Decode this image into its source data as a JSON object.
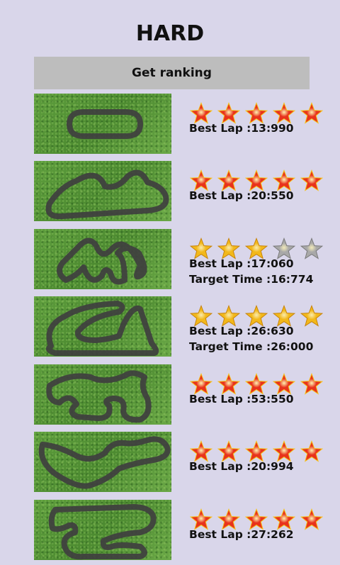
{
  "header": {
    "title": "HARD"
  },
  "ranking_button": {
    "label": "Get ranking"
  },
  "icons": {
    "red_star": "red-star-icon",
    "gold_star": "gold-star-icon",
    "grey_star": "grey-star-icon"
  },
  "colors": {
    "background": "#d9d6ea",
    "button": "#bdbdbd",
    "red_star": "#e8321c",
    "gold_star": "#f2b81b",
    "grey_star": "#a8a8a8",
    "track": "#4a4a4a"
  },
  "tracks": [
    {
      "stars": [
        "red",
        "red",
        "red",
        "red",
        "red"
      ],
      "best_lap": "Best Lap :13:990",
      "target_time": ""
    },
    {
      "stars": [
        "red",
        "red",
        "red",
        "red",
        "red"
      ],
      "best_lap": "Best Lap :20:550",
      "target_time": ""
    },
    {
      "stars": [
        "gold",
        "gold",
        "gold",
        "grey",
        "grey"
      ],
      "best_lap": "Best Lap :17:060",
      "target_time": "Target Time :16:774"
    },
    {
      "stars": [
        "gold",
        "gold",
        "gold",
        "gold",
        "gold"
      ],
      "best_lap": "Best Lap :26:630",
      "target_time": "Target Time :26:000"
    },
    {
      "stars": [
        "red",
        "red",
        "red",
        "red",
        "red"
      ],
      "best_lap": "Best Lap :53:550",
      "target_time": ""
    },
    {
      "stars": [
        "red",
        "red",
        "red",
        "red",
        "red"
      ],
      "best_lap": "Best Lap :20:994",
      "target_time": ""
    },
    {
      "stars": [
        "red",
        "red",
        "red",
        "red",
        "red"
      ],
      "best_lap": "Best Lap :27:262",
      "target_time": ""
    }
  ]
}
